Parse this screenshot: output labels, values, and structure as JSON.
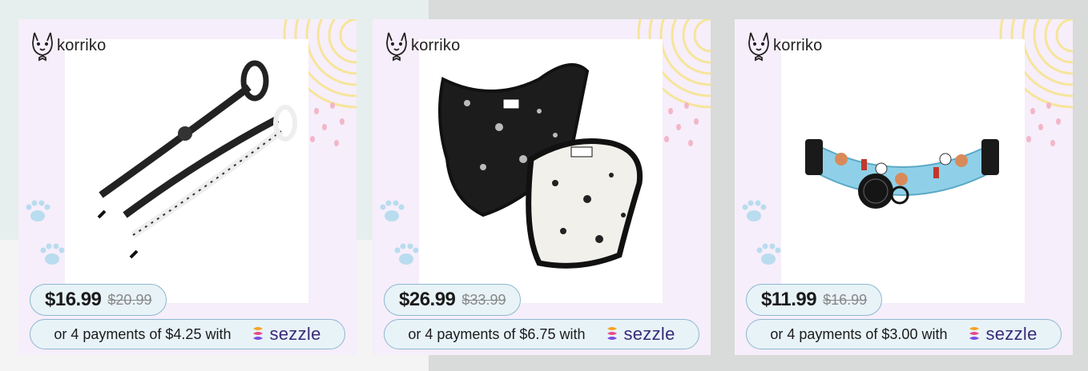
{
  "brand": {
    "name": "korriko"
  },
  "products": [
    {
      "image_alt": "leash product photo",
      "price_now": "$16.99",
      "price_was": "$20.99",
      "installment_text": "or 4 payments of $4.25 with",
      "provider": "sezzle"
    },
    {
      "image_alt": "harness product photo",
      "price_now": "$26.99",
      "price_was": "$33.99",
      "installment_text": "or 4 payments of $6.75 with",
      "provider": "sezzle"
    },
    {
      "image_alt": "collar product photo",
      "price_now": "$11.99",
      "price_was": "$16.99",
      "installment_text": "or 4 payments of $3.00 with",
      "provider": "sezzle"
    }
  ],
  "colors": {
    "card_bg": "#f6eefa",
    "pill_border": "#8db8cf",
    "pill_bg": "#e8f3f8",
    "sezzle_purple": "#3a2a78",
    "paw_blue": "#b9dcef",
    "deco_yellow": "#f6e59a",
    "deco_pink": "#f2b6c8"
  }
}
